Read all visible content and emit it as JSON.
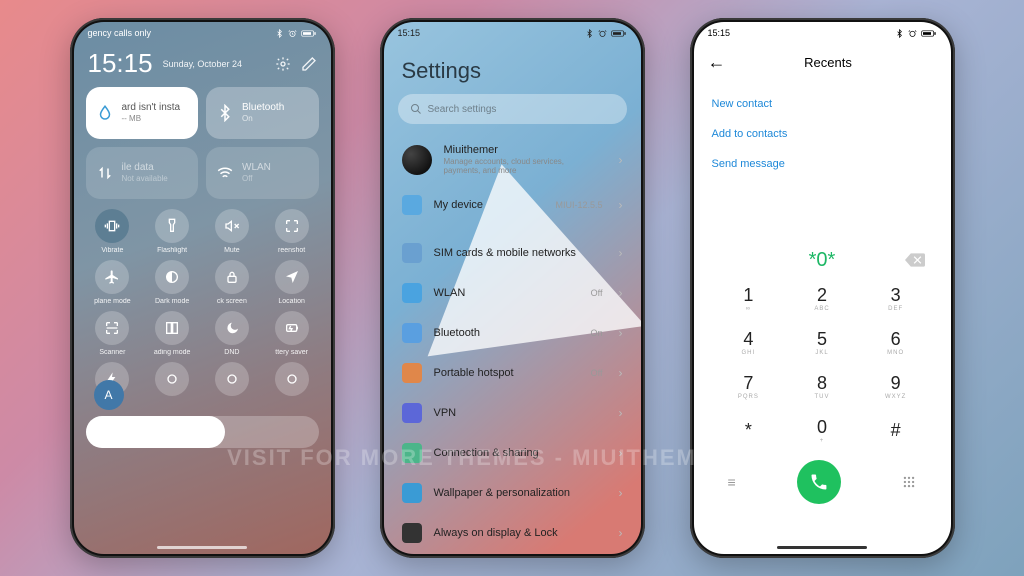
{
  "watermark": "Visit for more themes - miuithemer.com",
  "status": {
    "time": "15:15",
    "call_only": "gency calls only"
  },
  "phone1": {
    "time": "15:15",
    "date": "Sunday, October 24",
    "tiles": {
      "data_card": {
        "line1": "ard isn't insta",
        "line2": "-- MB"
      },
      "bluetooth": {
        "label": "Bluetooth",
        "state": "On"
      },
      "mobile_data": {
        "label": "ile data",
        "state": "Not available"
      },
      "wlan": {
        "label": "WLAN",
        "state": "Off"
      }
    },
    "toggles": [
      {
        "label": "Vibrate",
        "icon": "vibrate-icon",
        "on": true
      },
      {
        "label": "Flashlight",
        "icon": "flashlight-icon",
        "on": false
      },
      {
        "label": "Mute",
        "icon": "mute-icon",
        "on": false
      },
      {
        "label": "reenshot",
        "icon": "screenshot-icon",
        "on": false
      },
      {
        "label": "plane mode",
        "icon": "airplane-icon",
        "on": false
      },
      {
        "label": "Dark mode",
        "icon": "darkmode-icon",
        "on": false
      },
      {
        "label": "ck screen",
        "icon": "lock-icon",
        "on": false
      },
      {
        "label": "Location",
        "icon": "location-icon",
        "on": false
      },
      {
        "label": "Scanner",
        "icon": "scanner-icon",
        "on": false
      },
      {
        "label": "ading mode",
        "icon": "reading-icon",
        "on": false
      },
      {
        "label": "DND",
        "icon": "dnd-icon",
        "on": false
      },
      {
        "label": "ttery saver",
        "icon": "battery-saver-icon",
        "on": false
      },
      {
        "label": "",
        "icon": "bolt-icon",
        "on": false
      },
      {
        "label": "",
        "icon": "generic-icon",
        "on": false
      },
      {
        "label": "",
        "icon": "generic-icon",
        "on": false
      },
      {
        "label": "",
        "icon": "generic-icon",
        "on": false
      }
    ],
    "auto": "A"
  },
  "phone2": {
    "title": "Settings",
    "search_placeholder": "Search settings",
    "account": {
      "name": "Miuithemer",
      "sub": "Manage accounts, cloud services, payments, and more"
    },
    "my_device": {
      "label": "My device",
      "value": "MIUI-12.5.5"
    },
    "rows": [
      {
        "icon": "sim-icon",
        "color": "#6aa0d0",
        "label": "SIM cards & mobile networks",
        "value": ""
      },
      {
        "icon": "wifi-icon",
        "color": "#4aa3e0",
        "label": "WLAN",
        "value": "Off"
      },
      {
        "icon": "bluetooth-icon",
        "color": "#5a9fe0",
        "label": "Bluetooth",
        "value": "On"
      },
      {
        "icon": "hotspot-icon",
        "color": "#e0874a",
        "label": "Portable hotspot",
        "value": "Off"
      },
      {
        "icon": "vpn-icon",
        "color": "#5c67d8",
        "label": "VPN",
        "value": ""
      },
      {
        "icon": "share-icon",
        "color": "#4cb58a",
        "label": "Connection & sharing",
        "value": ""
      },
      {
        "icon": "wallpaper-icon",
        "color": "#3a9bd5",
        "label": "Wallpaper & personalization",
        "value": ""
      },
      {
        "icon": "aod-icon",
        "color": "#333",
        "label": "Always on display & Lock",
        "value": ""
      }
    ]
  },
  "phone3": {
    "header": "Recents",
    "links": {
      "new_contact": "New contact",
      "add_contacts": "Add to contacts",
      "send_message": "Send message"
    },
    "dialed": "*0*",
    "keys": [
      {
        "n": "1",
        "l": "∞"
      },
      {
        "n": "2",
        "l": "ABC"
      },
      {
        "n": "3",
        "l": "DEF"
      },
      {
        "n": "4",
        "l": "GHI"
      },
      {
        "n": "5",
        "l": "JKL"
      },
      {
        "n": "6",
        "l": "MNO"
      },
      {
        "n": "7",
        "l": "PQRS"
      },
      {
        "n": "8",
        "l": "TUV"
      },
      {
        "n": "9",
        "l": "WXYZ"
      },
      {
        "n": "*",
        "l": ""
      },
      {
        "n": "0",
        "l": "+"
      },
      {
        "n": "#",
        "l": ""
      }
    ]
  }
}
